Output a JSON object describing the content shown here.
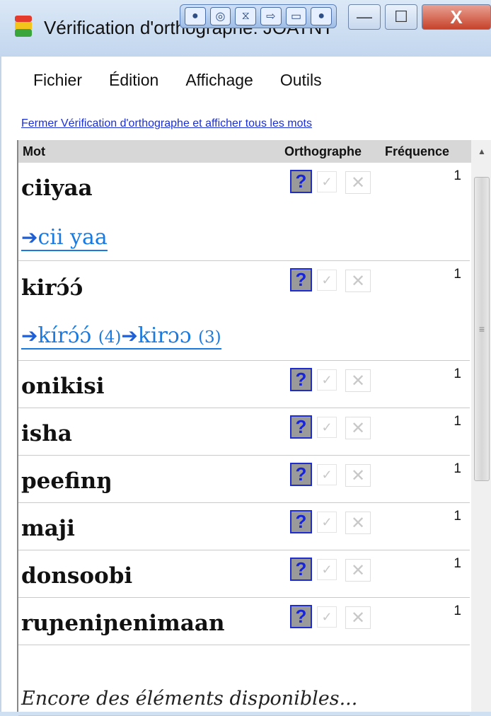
{
  "window": {
    "title": "Vérification d'orthographe: JOATNT"
  },
  "overlay_toolbar": {
    "icons": [
      "record-icon",
      "eye-icon",
      "filter-icon",
      "export-icon",
      "window-icon",
      "pin-icon"
    ]
  },
  "titlebar_buttons": {
    "minimize": "—",
    "maximize": "☐",
    "close": "X"
  },
  "menu": [
    "Fichier",
    "Édition",
    "Affichage",
    "Outils"
  ],
  "link": "Fermer Vérification d'orthographe et afficher tous les mots",
  "table": {
    "headers": {
      "word": "Mot",
      "spelling": "Orthographe",
      "frequency": "Fréquence"
    },
    "status_symbols": {
      "unknown": "?",
      "correct": "✓",
      "incorrect": "✕"
    },
    "rows": [
      {
        "word": "ciiyaa",
        "frequency": "1",
        "suggestion": {
          "arrow1": "➔",
          "text1": "cii yaa"
        }
      },
      {
        "word": "kirɔ́ɔ́",
        "frequency": "1",
        "suggestion": {
          "arrow1": "➔",
          "text1": "kírɔ́ɔ́",
          "count1": "(4)",
          "arrow2": "➔",
          "text2": "kirɔɔ",
          "count2": "(3)"
        }
      },
      {
        "word": "onikisi",
        "frequency": "1"
      },
      {
        "word": "isha",
        "frequency": "1"
      },
      {
        "word": "peefinŋ",
        "frequency": "1"
      },
      {
        "word": "maji",
        "frequency": "1"
      },
      {
        "word": "donsoobi",
        "frequency": "1"
      },
      {
        "word": "ruɲeniɲenimaan",
        "frequency": "1"
      }
    ],
    "more_text": "Encore des éléments disponibles..."
  },
  "scrollbar": {
    "up_arrow": "▲",
    "grip": "≡"
  },
  "colors": {
    "link": "#1a2fd6",
    "suggestion": "#1a7ae0",
    "question_button": "#9a9a9a",
    "question_border": "#1e2cd0"
  }
}
